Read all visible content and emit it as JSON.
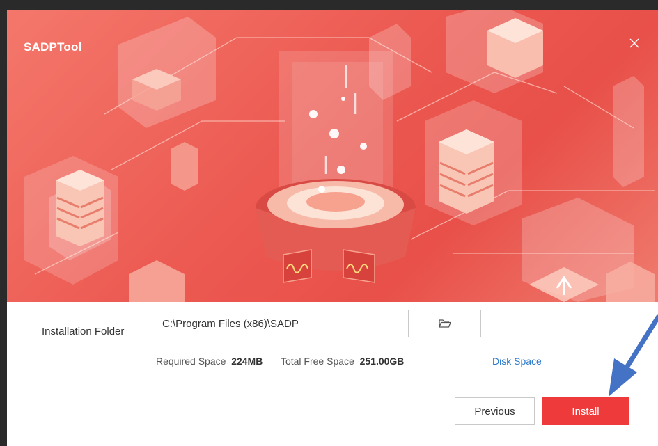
{
  "window": {
    "title": "SADPTool",
    "close_icon": "close-icon"
  },
  "form": {
    "folder_label": "Installation Folder",
    "folder_value": "C:\\Program Files (x86)\\SADP",
    "browse_icon": "folder-open-icon",
    "required_space_label": "Required Space",
    "required_space_value": "224MB",
    "free_space_label": "Total Free Space",
    "free_space_value": "251.00GB",
    "disk_space_link": "Disk Space"
  },
  "buttons": {
    "previous_label": "Previous",
    "install_label": "Install"
  },
  "colors": {
    "banner": "#ec5a52",
    "install_button": "#ee3a3a",
    "link": "#2c79cc",
    "annotation_arrow": "#4472c4"
  }
}
